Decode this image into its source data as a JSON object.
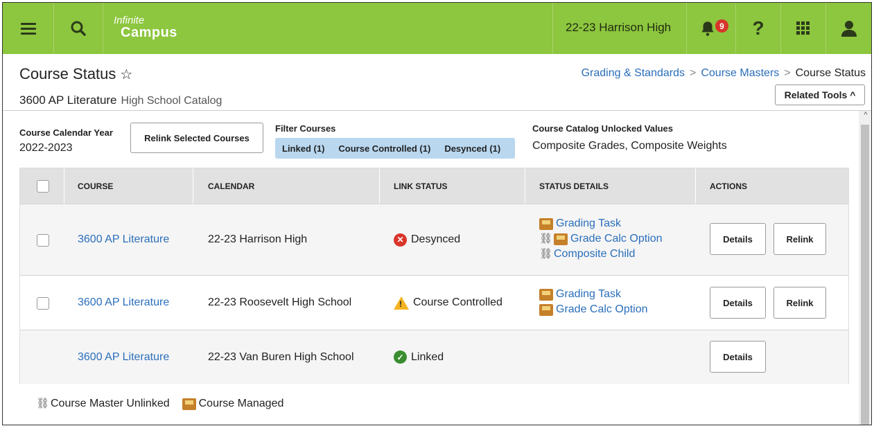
{
  "topbar": {
    "logo_line1": "Infinite",
    "logo_line2": "Campus",
    "school": "22-23 Harrison High",
    "notification_count": "9",
    "help_label": "?"
  },
  "page": {
    "title": "Course Status",
    "course": "3600 AP Literature",
    "catalog": "High School Catalog",
    "related_tools": "Related Tools ^"
  },
  "breadcrumb": {
    "item1": "Grading & Standards",
    "item2": "Course Masters",
    "current": "Course Status"
  },
  "controls": {
    "calendar_year_label": "Course Calendar Year",
    "calendar_year_value": "2022-2023",
    "relink_button": "Relink Selected Courses",
    "filter_label": "Filter Courses",
    "filters": [
      "Linked (1)",
      "Course Controlled (1)",
      "Desynced (1)"
    ],
    "unlocked_label": "Course Catalog Unlocked Values",
    "unlocked_value": "Composite Grades, Composite Weights"
  },
  "table": {
    "headers": [
      "COURSE",
      "CALENDAR",
      "LINK STATUS",
      "STATUS DETAILS",
      "ACTIONS"
    ],
    "rows": [
      {
        "course": "3600 AP Literature",
        "calendar": "22-23 Harrison High",
        "status": "Desynced",
        "details": [
          "Grading Task",
          "Grade Calc Option",
          "Composite Child"
        ],
        "details_btn": "Details",
        "relink_btn": "Relink"
      },
      {
        "course": "3600 AP Literature",
        "calendar": "22-23 Roosevelt High School",
        "status": "Course Controlled",
        "details": [
          "Grading Task",
          "Grade Calc Option"
        ],
        "details_btn": "Details",
        "relink_btn": "Relink"
      },
      {
        "course": "3600 AP Literature",
        "calendar": "22-23 Van Buren High School",
        "status": "Linked",
        "details": [],
        "details_btn": "Details"
      }
    ]
  },
  "legend": {
    "unlinked": "Course Master Unlinked",
    "managed": "Course Managed"
  },
  "colors": {
    "topbar": "#8dc63f",
    "link": "#2a6ebb",
    "desynced": "#d9352b",
    "warning": "#f5b321",
    "linked": "#3a8d2f"
  }
}
